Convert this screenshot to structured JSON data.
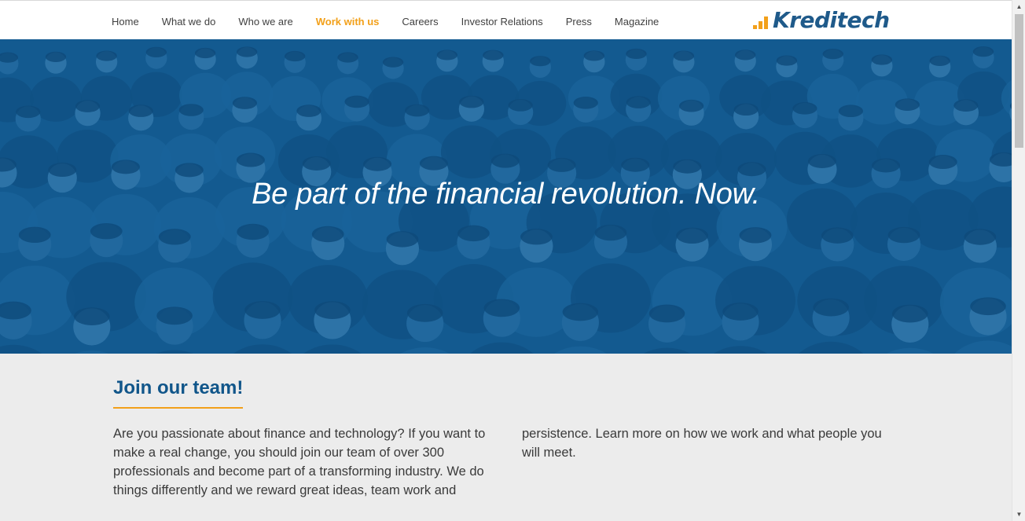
{
  "nav": {
    "items": [
      {
        "label": "Home",
        "active": false
      },
      {
        "label": "What we do",
        "active": false
      },
      {
        "label": "Who we are",
        "active": false
      },
      {
        "label": "Work with us",
        "active": true
      },
      {
        "label": "Careers",
        "active": false
      },
      {
        "label": "Investor Relations",
        "active": false
      },
      {
        "label": "Press",
        "active": false
      },
      {
        "label": "Magazine",
        "active": false
      }
    ]
  },
  "logo": {
    "text": "Kreditech",
    "icon": "signal-bars-icon"
  },
  "hero": {
    "title": "Be part of the financial revolution. Now.",
    "image": "team-crowd-photo"
  },
  "section": {
    "title": "Join our team!",
    "col_left": "Are you passionate about finance and technology? If you want to make a real change, you should join our team of over 300 professionals and become part of a transforming industry. We do things differently and we reward great ideas, team work and",
    "col_right": "persistence. Learn more on how we work and what people you will meet."
  },
  "colors": {
    "accent": "#f2a01a",
    "brand": "#11568a",
    "hero_tint": "#135a8e",
    "background": "#ececec"
  }
}
